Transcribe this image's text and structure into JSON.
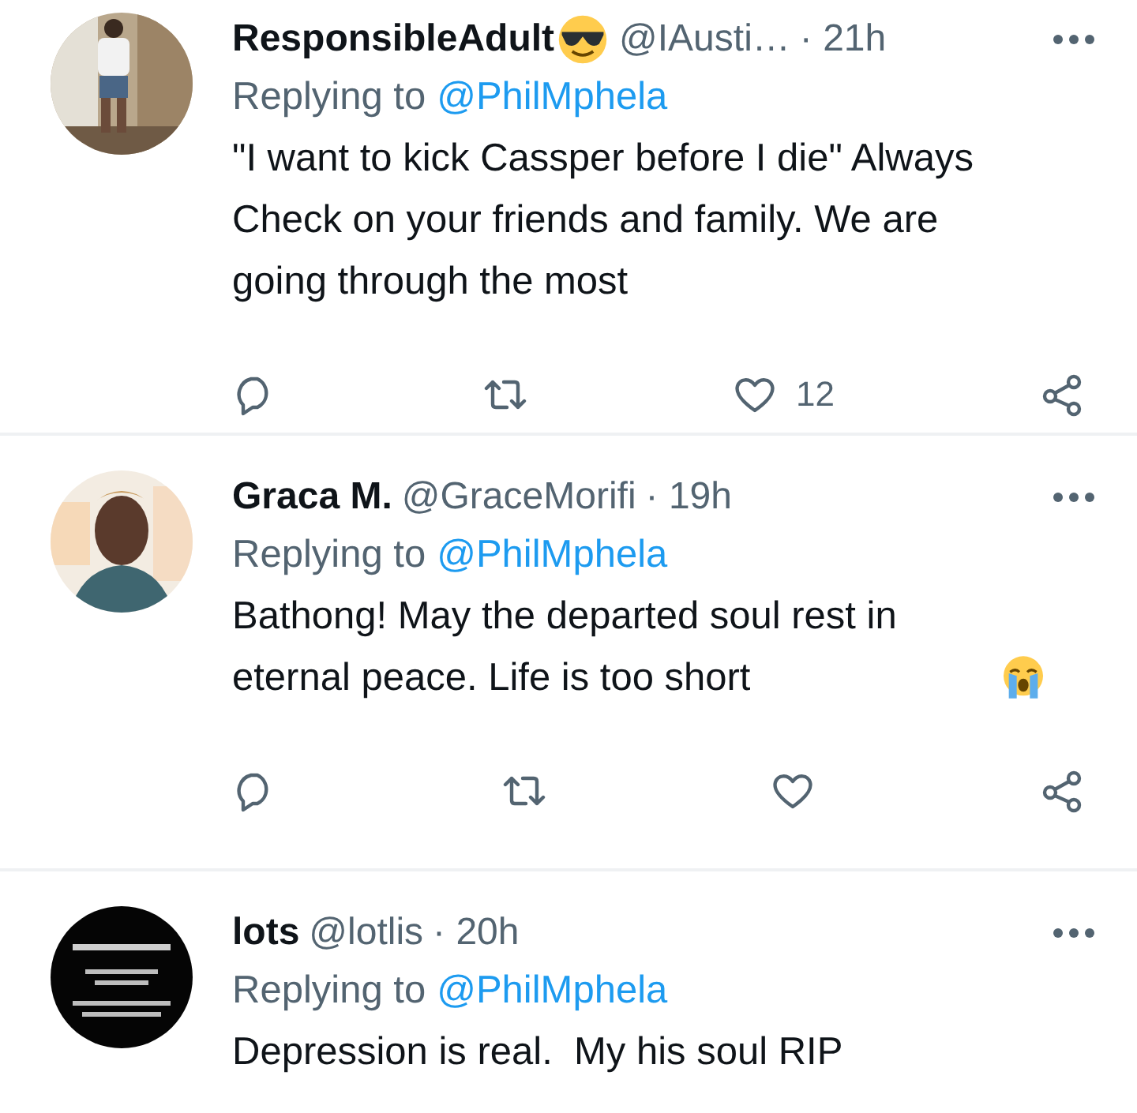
{
  "tweets": [
    {
      "author": "ResponsibleAdult",
      "handle": "@IAusti…",
      "time": "· 21h",
      "replying_label": "Replying to",
      "mention": "@PhilMphela",
      "body": "\"I want to kick Cassper before I die\" Always Check on your friends and family. We are going through the most",
      "like_count": "12"
    },
    {
      "author": "Graca M.",
      "handle": "@GraceMorifi",
      "time": "· 19h",
      "replying_label": "Replying to",
      "mention": "@PhilMphela",
      "body": "Bathong! May the departed soul rest in eternal peace. Life is too short"
    },
    {
      "author": "lots",
      "handle": "@lotlis",
      "time": "· 20h",
      "replying_label": "Replying to",
      "mention": "@PhilMphela",
      "body": "Depression is real.  My his soul RIP"
    }
  ]
}
